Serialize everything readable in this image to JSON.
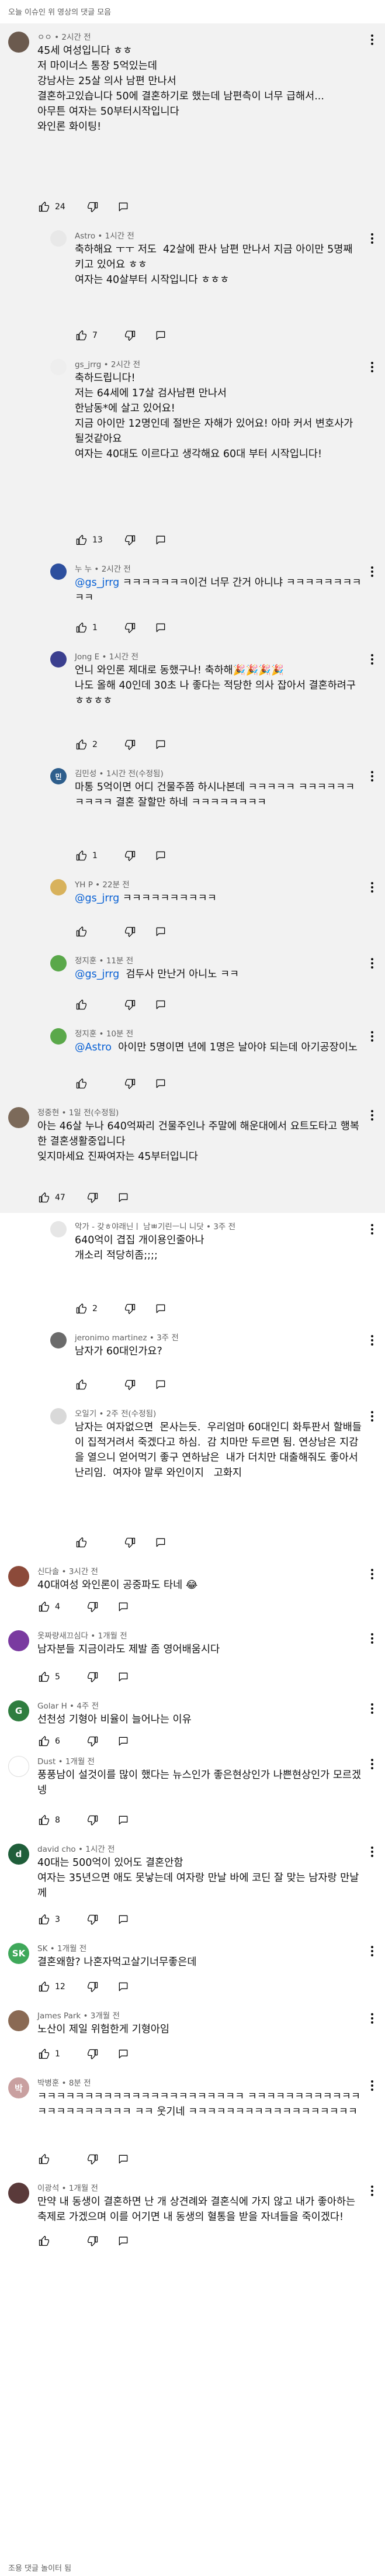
{
  "header": {
    "title": "오늘 이슈인 위 영상의 댓글 모음"
  },
  "footer": {
    "text": "조용 댓글 놀이터 됨"
  },
  "comments": [
    {
      "author": "ㅇㅇ",
      "time": "2시간 전",
      "body": "45세 여성입니다 ㅎㅎ\n저 마이너스 통장 5억있는데\n강남사는 25살 의사 남편 만나서\n결혼하고있습니다 50에 결혼하기로 했는데 남편측이 너무 급해서...\n아무튼 여자는 50부터시작입니다\n와인론 화이팅!",
      "likes": "24",
      "reply": false,
      "highlight": true,
      "avatar_color": "#6b5a4e",
      "avatar_text": ""
    },
    {
      "author": "Astro",
      "time": "1시간 전",
      "body": "축하해요 ㅜㅜ 저도  42살에 판사 남편 만나서 지금 아이만 5명째 키고 있어요 ㅎㅎ\n여자는 40살부터 시작입니다 ㅎㅎㅎ",
      "likes": "7",
      "reply": true,
      "highlight": true,
      "avatar_color": "#e8e8e8",
      "avatar_text": ""
    },
    {
      "author": "gs_jrrg",
      "time": "2시간 전",
      "body": "축하드립니다!\n저는 64세에 17살 검사남편 만나서\n한남동*에 살고 있어요!\n지금 아이만 12명인데 절반은 자해가 있어요! 아마 커서 변호사가 될것같아요\n여자는 40대도 이르다고 생각해요 60대 부터 시작입니다!",
      "likes": "13",
      "reply": true,
      "highlight": true,
      "avatar_color": "#eeeeee",
      "avatar_text": ""
    },
    {
      "author": "누 누",
      "time": "2시간 전",
      "mention": "@gs_jrrg",
      "body": " ㅋㅋㅋㅋㅋㅋㅋ이건 너무 간거 아니냐 ㅋㅋㅋㅋㅋㅋㅋㅋㅋㅋ",
      "likes": "1",
      "reply": true,
      "highlight": true,
      "avatar_color": "#2d4f9e",
      "avatar_text": ""
    },
    {
      "author": "Jong E",
      "time": "1시간 전",
      "body": "언니 와인론 제대로 동했구나! 축하해🎉🎉🎉🎉\n나도 올해 40인데 30초 나 좋다는 적당한 의사 잡아서 결혼하려구 ㅎㅎㅎㅎ",
      "likes": "2",
      "reply": true,
      "highlight": true,
      "avatar_color": "#3b3f8f",
      "avatar_text": ""
    },
    {
      "author": "김민성",
      "time": "1시간 전(수정됨)",
      "body": "마통 5억이면 어디 건물주쯤 하시나본데 ㅋㅋㅋㅋㅋ ㅋㅋㅋㅋㅋㅋㅋㅋㅋㅋ 결혼 잘할만 하네 ㅋㅋㅋㅋㅋㅋㅋㅋ",
      "likes": "1",
      "reply": true,
      "highlight": true,
      "avatar_color": "#2e5e8c",
      "avatar_text": "민"
    },
    {
      "author": "YH P",
      "time": "22분 전",
      "mention": "@gs_jrrg",
      "body": " ㅋㅋㅋㅋㅋㅋㅋㅋㅋㅋ",
      "likes": "",
      "reply": true,
      "highlight": true,
      "avatar_color": "#d8b25c",
      "avatar_text": ""
    },
    {
      "author": "정지훈",
      "time": "11분 전",
      "mention": "@gs_jrrg",
      "body": "  검두사 만난거 아니노 ㅋㅋ",
      "likes": "",
      "reply": true,
      "highlight": true,
      "avatar_color": "#5aa84a",
      "avatar_text": ""
    },
    {
      "author": "정지훈",
      "time": "10분 전",
      "mention": "@Astro",
      "body": "  아이만 5명이면 년에 1명은 날아야 되는데 아기공장이노",
      "likes": "",
      "reply": true,
      "highlight": true,
      "avatar_color": "#5aa84a",
      "avatar_text": ""
    },
    {
      "author": "정중현",
      "time": "1일 전(수정됨)",
      "body": "아는 46살 누나 640억짜리 건물주인나 주말에 해운대에서 요트도타고 행복한 결혼생활중입니다\n잊지마세요 진짜여자는 45부터입니다",
      "likes": "47",
      "reply": false,
      "highlight": true,
      "avatar_color": "#7c6a5a",
      "avatar_text": ""
    },
    {
      "author": "악가 - 갖ㅎ야래닌ㅣ 남ㅃ기린ㅡ니 니닷",
      "time": "3주 전",
      "body": "640억이 겹집 개이용인줄아나\n개소리 적당히좀;;;;",
      "likes": "2",
      "reply": true,
      "highlight": false,
      "avatar_color": "#e6e6e6",
      "avatar_text": ""
    },
    {
      "author": "jeronimo martinez",
      "time": "3주 전",
      "body": "남자가 60대인가요?",
      "likes": "",
      "reply": true,
      "highlight": false,
      "avatar_color": "#6b6b6b",
      "avatar_text": ""
    },
    {
      "author": "오일기",
      "time": "2주 전(수정됨)",
      "body": "남자는 여자없으면  몬사는듯.  우리엄마 60대인디 화투판서 할배들이 집적거려서 죽겠다고 하심.  감 치마만 두르면 됨. 연상남은 지감을 열으니 얻어먹기 좋구 연하남은  내가 더치만 대출해줘도 좋아서 난리임.  여자야 말루 와인이지   고화지",
      "likes": "",
      "reply": true,
      "highlight": false,
      "avatar_color": "#d9d9d9",
      "avatar_text": ""
    },
    {
      "author": "신다솔",
      "time": "3시간 전",
      "body": "40대여성 와인론이 공중파도 타네 😂",
      "likes": "4",
      "reply": false,
      "highlight": false,
      "avatar_color": "#8c4a3a",
      "avatar_text": ""
    },
    {
      "author": "옷짜량새끄심다",
      "time": "1개월 전",
      "body": "남자분들 지금이라도 제발 좀 영어배움시다",
      "likes": "5",
      "reply": false,
      "highlight": false,
      "avatar_color": "#7a3aa0",
      "avatar_text": ""
    },
    {
      "author": "Golar H",
      "time": "4주 전",
      "body": "선천성 기형아 비율이 늘어나는 이유",
      "likes": "6",
      "reply": false,
      "highlight": false,
      "avatar_color": "#2f7d3f",
      "avatar_text": "G"
    },
    {
      "author": "Dust",
      "time": "1개월 전",
      "body": "풍풍남이 설것이를 많이 했다는 뉴스인가 좋은현상인가 나쁜현상인가 모르겠넹",
      "likes": "8",
      "reply": false,
      "highlight": false,
      "avatar_color": "#ffffff",
      "avatar_text": ""
    },
    {
      "author": "david cho",
      "time": "1시간 전",
      "body": "40대는 500억이 있어도 결혼안함\n여자는 35년으면 애도 못낳는데 여자랑 만날 바에 코딘 잘 맞는 남자랑 만날께",
      "likes": "3",
      "reply": false,
      "highlight": false,
      "avatar_color": "#1f5e3a",
      "avatar_text": "d"
    },
    {
      "author": "SK",
      "time": "1개월 전",
      "body": "결혼왜함? 나혼자먹고살기너무좋은데",
      "likes": "12",
      "reply": false,
      "highlight": false,
      "avatar_color": "#3fa85a",
      "avatar_text": "SK"
    },
    {
      "author": "James Park",
      "time": "3개월 전",
      "body": "노산이 제일 위험한게 기형아임",
      "likes": "1",
      "reply": false,
      "highlight": false,
      "avatar_color": "#8a6a54",
      "avatar_text": ""
    },
    {
      "author": "박병훈",
      "time": "8분 전",
      "body": "ㅋㅋㅋㅋㅋㅋㅋㅋㅋㅋㅋㅋㅋㅋㅋㅋㅋㅋㅋㅋㅋㅋ ㅋㅋㅋㅋㅋㅋㅋㅋㅋㅋㅋㅋㅋㅋㅋㅋㅋㅋㅋㅋㅋㅋ ㅋㅋ 웃기네 ㅋㅋㅋㅋㅋㅋㅋㅋㅋㅋㅋㅋㅋㅋㅋㅋㅋㅋ",
      "likes": "",
      "reply": false,
      "highlight": false,
      "avatar_color": "#c9a0a0",
      "avatar_text": "박"
    },
    {
      "author": "이광석",
      "time": "1개월 전",
      "body": "만약 내 동생이 결혼하면 난 개 상견례와 결혼식에 가지 않고 내가 좋아하는 축제로 가겠으며 이를 어기면 내 동생의 혈통을 받을 자녀들을 죽이겠다!",
      "likes": "",
      "reply": false,
      "highlight": false,
      "avatar_color": "#5a3a3a",
      "avatar_text": ""
    }
  ]
}
